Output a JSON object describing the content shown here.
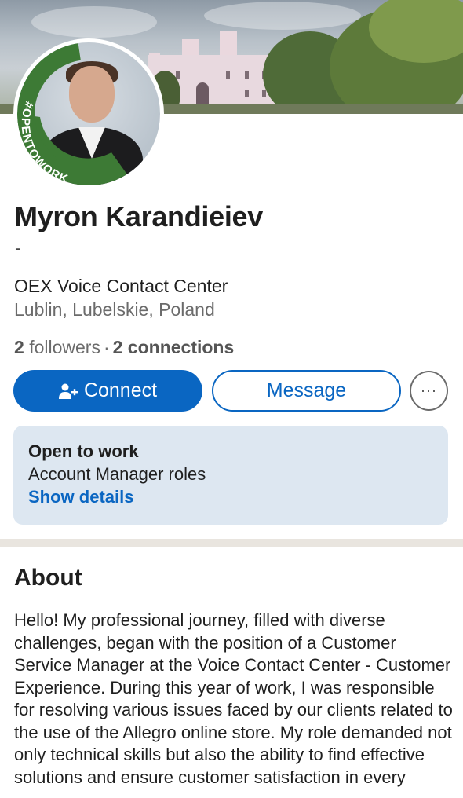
{
  "profile": {
    "name": "Myron Karandieiev",
    "headline": "-",
    "company": "OEX Voice Contact Center",
    "location": "Lublin, Lubelskie, Poland",
    "followers_count": "2",
    "followers_label": "followers",
    "connections_count": "2 connections",
    "separator": "·",
    "avatar_badge": "#OPENTOWORK"
  },
  "actions": {
    "connect_label": "Connect",
    "message_label": "Message",
    "more_label": "···"
  },
  "open_to_work": {
    "title": "Open to work",
    "roles": "Account Manager roles",
    "link": "Show details"
  },
  "about": {
    "title": "About",
    "text": "Hello! My professional journey, filled with diverse challenges, began with the position of a Customer Service Manager at the Voice Contact Center - Customer Experience. During this year of work, I was responsible for resolving various issues faced by our clients related to the use of the Allegro online store. My role demanded not only technical skills but also the ability to find effective solutions and ensure customer satisfaction in every situation."
  },
  "colors": {
    "brand_blue": "#0a66c2",
    "open_to_work_green": "#3d7a35",
    "card_bg": "#dde7f1"
  },
  "icons": {
    "connect": "person-add-icon",
    "more": "more-horizontal-icon"
  }
}
